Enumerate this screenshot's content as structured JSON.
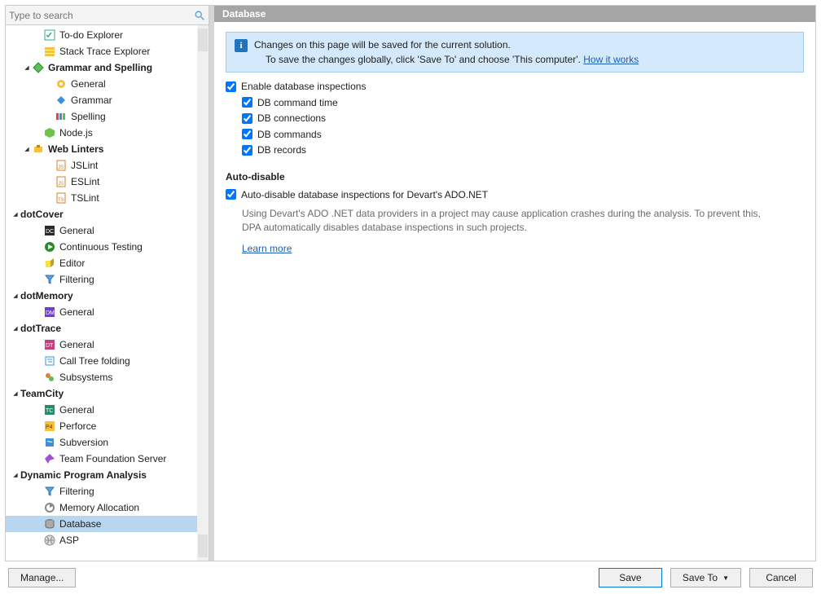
{
  "search": {
    "placeholder": "Type to search"
  },
  "header": {
    "title": "Database"
  },
  "banner": {
    "line1": "Changes on this page will be saved for the current solution.",
    "line2_prefix": "To save the changes globally, click 'Save To' and choose 'This computer'. ",
    "link": "How it works"
  },
  "checkboxes": {
    "enable_db": "Enable database inspections",
    "db_cmd_time": "DB command time",
    "db_connections": "DB connections",
    "db_commands": "DB commands",
    "db_records": "DB records"
  },
  "auto_disable": {
    "title": "Auto-disable",
    "chk": "Auto-disable database inspections for Devart's ADO.NET",
    "help": "Using Devart's ADO .NET data providers in a project may cause application crashes during the analysis. To prevent this, DPA automatically disables database inspections in such projects.",
    "learn_more": "Learn more"
  },
  "footer": {
    "manage": "Manage...",
    "save": "Save",
    "saveto": "Save To",
    "cancel": "Cancel"
  },
  "tree": [
    {
      "label": "To-do Explorer",
      "indent": 2,
      "icon": "todo",
      "exp": ""
    },
    {
      "label": "Stack Trace Explorer",
      "indent": 2,
      "icon": "stack",
      "exp": ""
    },
    {
      "label": "Grammar and Spelling",
      "indent": 1,
      "icon": "grammar",
      "exp": "▾",
      "cat": true
    },
    {
      "label": "General",
      "indent": 3,
      "icon": "gear",
      "exp": ""
    },
    {
      "label": "Grammar",
      "indent": 3,
      "icon": "diamond",
      "exp": ""
    },
    {
      "label": "Spelling",
      "indent": 3,
      "icon": "spell",
      "exp": ""
    },
    {
      "label": "Node.js",
      "indent": 2,
      "icon": "node",
      "exp": ""
    },
    {
      "label": "Web Linters",
      "indent": 1,
      "icon": "lint",
      "exp": "▾",
      "cat": true
    },
    {
      "label": "JSLint",
      "indent": 3,
      "icon": "jsfile",
      "exp": ""
    },
    {
      "label": "ESLint",
      "indent": 3,
      "icon": "jsfile",
      "exp": ""
    },
    {
      "label": "TSLint",
      "indent": 3,
      "icon": "tsfile",
      "exp": ""
    },
    {
      "label": "dotCover",
      "indent": 0,
      "icon": "",
      "exp": "▾",
      "cat": true
    },
    {
      "label": "General",
      "indent": 2,
      "icon": "dc",
      "exp": ""
    },
    {
      "label": "Continuous Testing",
      "indent": 2,
      "icon": "ct",
      "exp": ""
    },
    {
      "label": "Editor",
      "indent": 2,
      "icon": "editor",
      "exp": ""
    },
    {
      "label": "Filtering",
      "indent": 2,
      "icon": "filter",
      "exp": ""
    },
    {
      "label": "dotMemory",
      "indent": 0,
      "icon": "",
      "exp": "▾",
      "cat": true
    },
    {
      "label": "General",
      "indent": 2,
      "icon": "dm",
      "exp": ""
    },
    {
      "label": "dotTrace",
      "indent": 0,
      "icon": "",
      "exp": "▾",
      "cat": true
    },
    {
      "label": "General",
      "indent": 2,
      "icon": "dt",
      "exp": ""
    },
    {
      "label": "Call Tree folding",
      "indent": 2,
      "icon": "calltree",
      "exp": ""
    },
    {
      "label": "Subsystems",
      "indent": 2,
      "icon": "subsys",
      "exp": ""
    },
    {
      "label": "TeamCity",
      "indent": 0,
      "icon": "",
      "exp": "▾",
      "cat": true
    },
    {
      "label": "General",
      "indent": 2,
      "icon": "tc",
      "exp": ""
    },
    {
      "label": "Perforce",
      "indent": 2,
      "icon": "p4",
      "exp": ""
    },
    {
      "label": "Subversion",
      "indent": 2,
      "icon": "svn",
      "exp": ""
    },
    {
      "label": "Team Foundation Server",
      "indent": 2,
      "icon": "tfs",
      "exp": ""
    },
    {
      "label": "Dynamic Program Analysis",
      "indent": 0,
      "icon": "",
      "exp": "▾",
      "cat": true
    },
    {
      "label": "Filtering",
      "indent": 2,
      "icon": "filter",
      "exp": ""
    },
    {
      "label": "Memory Allocation",
      "indent": 2,
      "icon": "mem",
      "exp": ""
    },
    {
      "label": "Database",
      "indent": 2,
      "icon": "db",
      "exp": "",
      "selected": true
    },
    {
      "label": "ASP",
      "indent": 2,
      "icon": "asp",
      "exp": ""
    }
  ]
}
